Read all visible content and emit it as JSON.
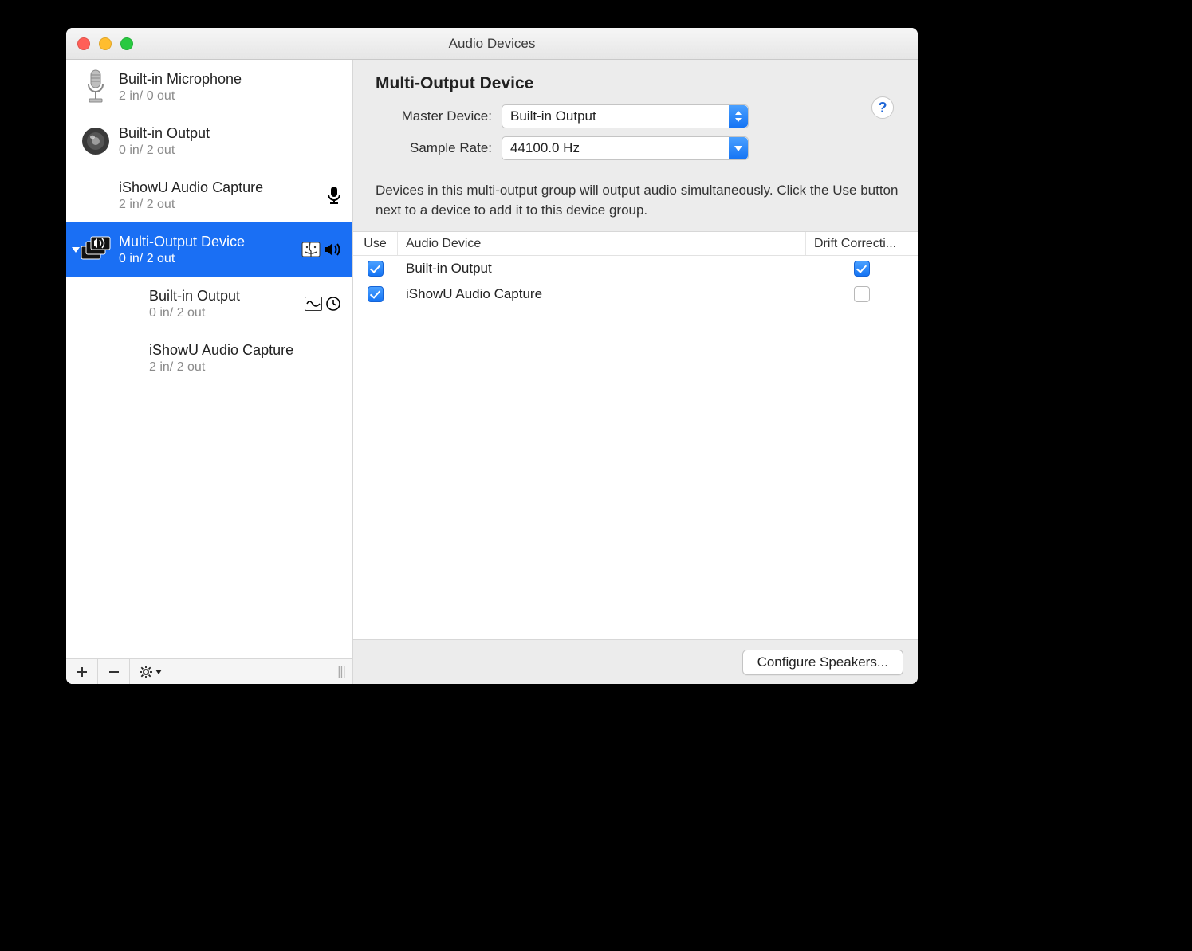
{
  "window": {
    "title": "Audio Devices"
  },
  "sidebar": {
    "devices": [
      {
        "name": "Built-in Microphone",
        "io": "2 in/ 0 out"
      },
      {
        "name": "Built-in Output",
        "io": "0 in/ 2 out"
      },
      {
        "name": "iShowU Audio Capture",
        "io": "2 in/ 2 out"
      },
      {
        "name": "Multi-Output Device",
        "io": "0 in/ 2 out"
      },
      {
        "name": "Built-in Output",
        "io": "0 in/ 2 out"
      },
      {
        "name": "iShowU Audio Capture",
        "io": "2 in/ 2 out"
      }
    ]
  },
  "main": {
    "title": "Multi-Output Device",
    "master_label": "Master Device:",
    "master_value": "Built-in Output",
    "rate_label": "Sample Rate:",
    "rate_value": "44100.0 Hz",
    "help": "?",
    "info": "Devices in this multi-output group will output audio simultaneously. Click the Use button next to a device to add it to this device group.",
    "columns": {
      "use": "Use",
      "device": "Audio Device",
      "drift": "Drift Correcti..."
    },
    "rows": [
      {
        "name": "Built-in Output",
        "use": true,
        "drift": true
      },
      {
        "name": "iShowU Audio Capture",
        "use": true,
        "drift": false
      }
    ],
    "configure_btn": "Configure Speakers..."
  }
}
